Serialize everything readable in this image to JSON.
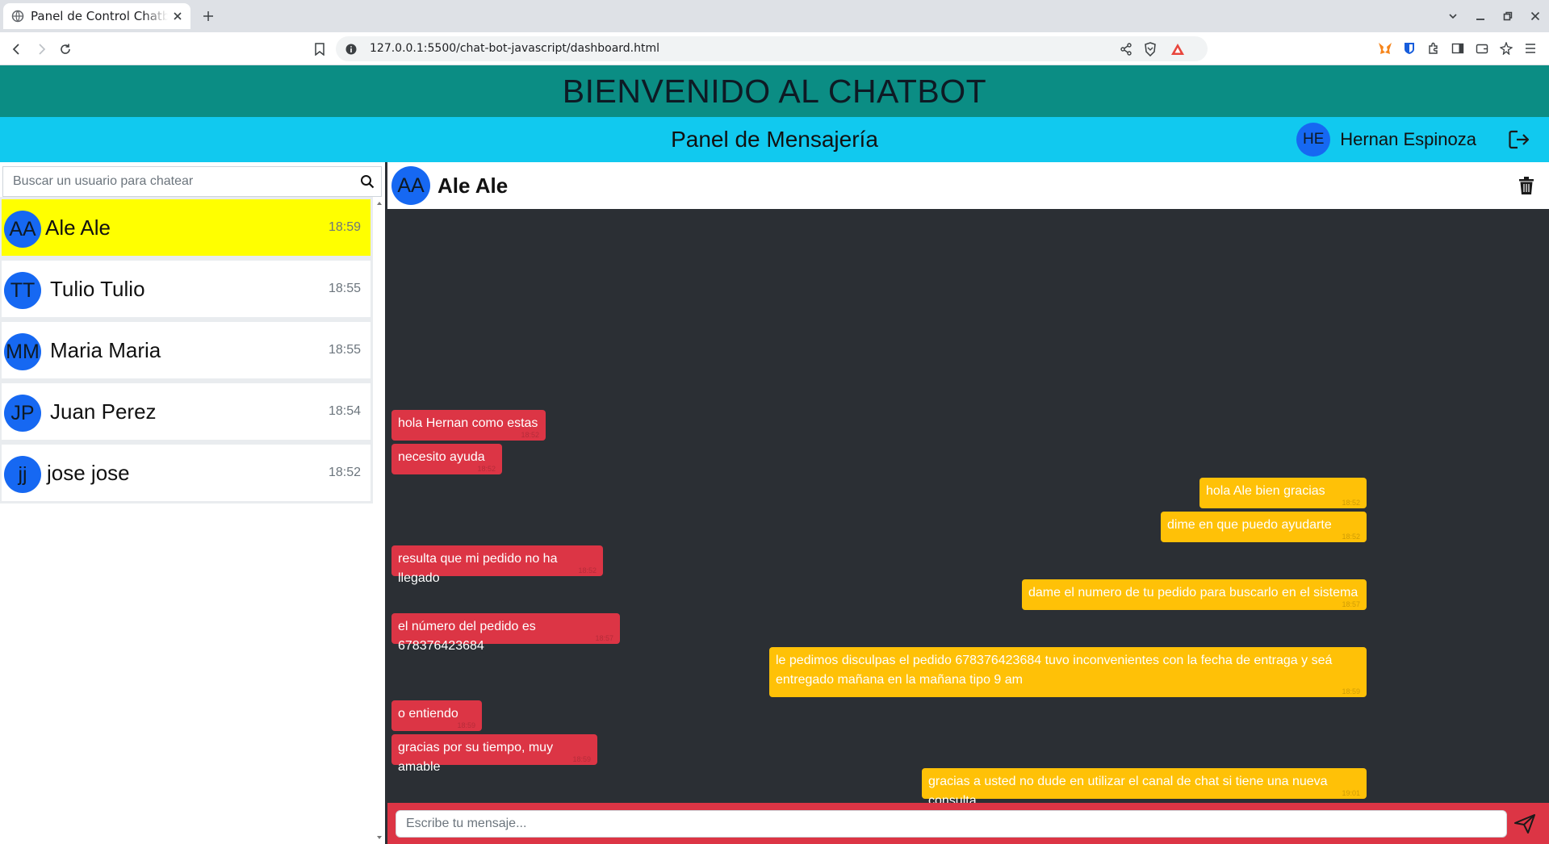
{
  "browser": {
    "tab_title": "Panel de Control Chatbot",
    "url": "127.0.0.1:5500/chat-bot-javascript/dashboard.html"
  },
  "header": {
    "welcome_title": "BIENVENIDO AL CHATBOT",
    "panel_title": "Panel de Mensajería",
    "user_initials": "HE",
    "user_name": "Hernan Espinoza",
    "logout_icon": "logout-icon"
  },
  "sidebar": {
    "search_placeholder": "Buscar un usuario para chatear",
    "chats": [
      {
        "initials": "AA",
        "name": "Ale Ale",
        "time": "18:59",
        "active": true
      },
      {
        "initials": "TT",
        "name": "Tulio Tulio",
        "time": "18:55",
        "active": false
      },
      {
        "initials": "MM",
        "name": "Maria Maria",
        "time": "18:55",
        "active": false
      },
      {
        "initials": "JP",
        "name": "Juan Perez",
        "time": "18:54",
        "active": false
      },
      {
        "initials": "jj",
        "name": "jose jose",
        "time": "18:52",
        "active": false
      }
    ]
  },
  "chat": {
    "contact_initials": "AA",
    "contact_name": "Ale Ale",
    "messages": [
      {
        "from": "received",
        "text": "hola Hernan como estas",
        "time": "18:52"
      },
      {
        "from": "received",
        "text": "necesito ayuda",
        "time": "18:52"
      },
      {
        "from": "sent",
        "text": "hola Ale bien gracias",
        "time": "18:52"
      },
      {
        "from": "sent",
        "text": "dime en que puedo ayudarte",
        "time": "18:52"
      },
      {
        "from": "received",
        "text": "resulta que mi pedido no ha llegado",
        "time": "18:52"
      },
      {
        "from": "sent",
        "text": "dame el numero de tu pedido para buscarlo en el sistema",
        "time": "18:57"
      },
      {
        "from": "received",
        "text": "el número del pedido es 678376423684",
        "time": "18:57"
      },
      {
        "from": "sent",
        "text": "le pedimos disculpas el pedido 678376423684 tuvo inconvenientes con la fecha de entraga y seá entregado mañana en la mañana tipo 9 am",
        "time": "18:59"
      },
      {
        "from": "received",
        "text": "o entiendo",
        "time": "18:59"
      },
      {
        "from": "received",
        "text": "gracias por su tiempo, muy amable",
        "time": "18:59"
      },
      {
        "from": "sent",
        "text": "gracias a usted no dude en utilizar el canal de chat si tiene una nueva consulta",
        "time": "19:01"
      }
    ],
    "composer_placeholder": "Escribe tu mensaje..."
  },
  "colors": {
    "welcome_bar": "#0b8d84",
    "panel_bar": "#11c9ef",
    "avatar": "#1668f2",
    "active_chat": "#ffff00",
    "received_bubble": "#dc3545",
    "sent_bubble": "#ffc107",
    "chat_background": "#2b2f34"
  }
}
